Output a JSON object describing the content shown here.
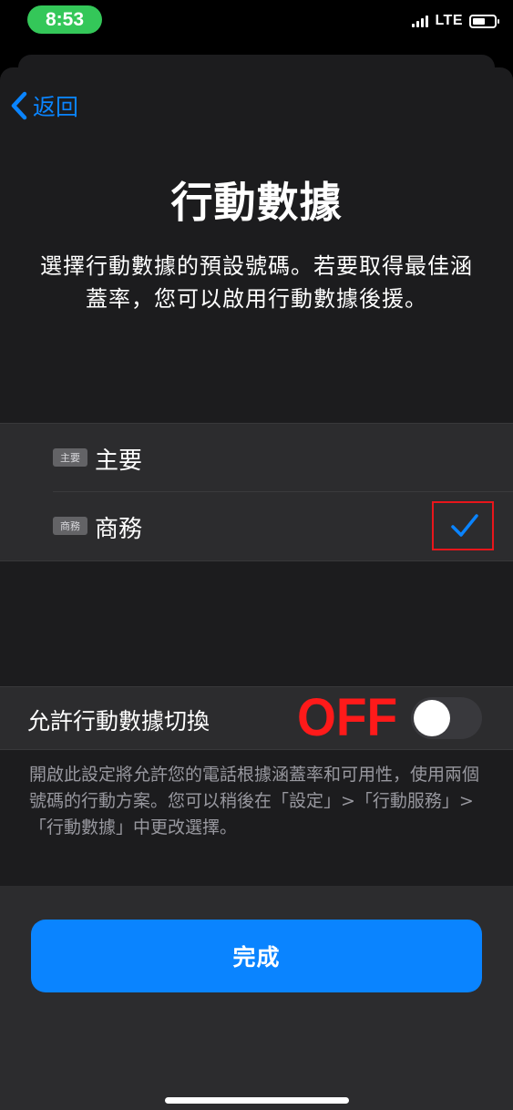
{
  "status_bar": {
    "time": "8:53",
    "network": "LTE",
    "time_pill_color": "#34c759"
  },
  "nav": {
    "back_label": "返回"
  },
  "header": {
    "title": "行動數據",
    "subtitle": "選擇行動數據的預設號碼。若要取得最佳涵蓋率，您可以啟用行動數據後援。"
  },
  "lines": [
    {
      "badge": "主要",
      "label": "主要",
      "selected": false
    },
    {
      "badge": "商務",
      "label": "商務",
      "selected": true
    }
  ],
  "switching": {
    "label": "允許行動數據切換",
    "state": "off",
    "annotation": "OFF",
    "description": "開啟此設定將允許您的電話根據涵蓋率和可用性，使用兩個號碼的行動方案。您可以稍後在「設定」>「行動服務」>「行動數據」中更改選擇。"
  },
  "done_button": {
    "label": "完成"
  },
  "colors": {
    "accent": "#0a84ff",
    "annotation_red": "#e8161b",
    "background": "#1c1c1e"
  }
}
